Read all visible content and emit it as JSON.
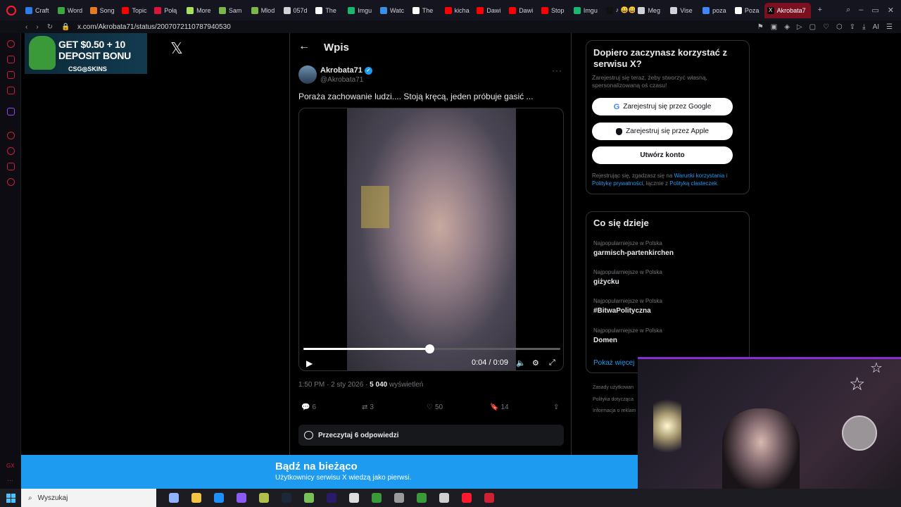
{
  "browser": {
    "tabs": [
      {
        "label": "Craft",
        "color": "#2b7de9"
      },
      {
        "label": "Word",
        "color": "#3ea63e"
      },
      {
        "label": "Song",
        "color": "#e37b26"
      },
      {
        "label": "Topic",
        "color": "#ff0000"
      },
      {
        "label": "Połą",
        "color": "#dc143c"
      },
      {
        "label": "More",
        "color": "#a8e05c"
      },
      {
        "label": "Sam",
        "color": "#7ab648"
      },
      {
        "label": "Mlod",
        "color": "#7ab648"
      },
      {
        "label": "057d",
        "color": "#cfd2d6"
      },
      {
        "label": "The",
        "color": "#ffffff"
      },
      {
        "label": "Imgu",
        "color": "#1bb76e"
      },
      {
        "label": "Watc",
        "color": "#3a8ee6"
      },
      {
        "label": "The",
        "color": "#ffffff"
      },
      {
        "label": "kicha",
        "color": "#ff0000"
      },
      {
        "label": "Dawi",
        "color": "#ff0000"
      },
      {
        "label": "Dawi",
        "color": "#ff0000"
      },
      {
        "label": "Stop",
        "color": "#ff0000"
      },
      {
        "label": "Imgu",
        "color": "#1bb76e"
      },
      {
        "label": "♪ 😀😀",
        "color": "#111111"
      },
      {
        "label": "Meg",
        "color": "#cfd2d6"
      },
      {
        "label": "Vise",
        "color": "#cfd2d6"
      },
      {
        "label": "poza",
        "color": "#4285f4"
      },
      {
        "label": "Poza",
        "color": "#ffffff"
      }
    ],
    "active_tab": "Akrobata7",
    "url": "x.com/Akrobata71/status/2007072110787940530"
  },
  "ad": {
    "line1": "GET $0.50 + 10",
    "line2": "DEPOSIT BONU",
    "brand": "CSG◎SKINS"
  },
  "x_logo": "𝕏",
  "post": {
    "header_title": "Wpis",
    "display_name": "Akrobata71",
    "handle": "@Akrobata71",
    "text": "Poraża zachowanie ludzi.... Stoją kręcą, jeden próbuje gasić ...",
    "video": {
      "current": "0:04",
      "total": "0:09",
      "time_display": "0:04 / 0:09",
      "progress": 0.49
    },
    "timestamp": "1:50 PM · 2 sty 2026 · ",
    "views_count": "5 040",
    "views_label": " wyświetleń",
    "replies": "6",
    "reposts": "3",
    "likes": "50",
    "bookmarks": "14",
    "read_replies": "Przeczytaj 6 odpowiedzi"
  },
  "signup": {
    "heading": "Dopiero zaczynasz korzystać z serwisu X?",
    "subtext": "Zarejestruj się teraz, żeby stworzyć własną, spersonalizowaną oś czasu!",
    "google_btn": "Zarejestruj się przez Google",
    "apple_btn": "Zarejestruj się przez Apple",
    "create_btn": "Utwórz konto",
    "legal_pre": "Rejestrując się, zgadzasz się na ",
    "legal_terms": "Warunki korzystania",
    "legal_and": " i ",
    "legal_privacy": "Politykę prywatności",
    "legal_mid": ", łącznie z ",
    "legal_cookies": "Polityką clasteczek",
    "legal_end": "."
  },
  "trends": {
    "heading": "Co się dzieje",
    "items": [
      {
        "context": "Najpopularniejsze w Polska",
        "name": "garmisch-partenkirchen"
      },
      {
        "context": "Najpopularniejsze w Polska",
        "name": "giżycku"
      },
      {
        "context": "Najpopularniejsze w Polska",
        "name": "#BitwaPolityczna"
      },
      {
        "context": "Najpopularniejsze w Polska",
        "name": "Domen"
      }
    ],
    "show_more": "Pokaż więcej"
  },
  "footer": {
    "l1": "Zasady użytkowan",
    "l2": "Polityka dotycząca",
    "l3": "Informacja o reklam"
  },
  "banner": {
    "title": "Bądź na bieżąco",
    "subtitle": "Użytkownicy serwisu X wiedzą jako pierwsi."
  },
  "taskbar": {
    "search_placeholder": "Wyszukaj",
    "apps": [
      "#8fb3ff",
      "#f4c542",
      "#1e90ff",
      "#8a5cf5",
      "#b0c04a",
      "#1b2838",
      "#78c05a",
      "#2a1a6a",
      "#dddddd",
      "#3a9a3a",
      "#9a9a9a",
      "#3a9a3a",
      "#cfcfcf",
      "#ff1b2d",
      "#cc2233"
    ]
  },
  "colors": {
    "accent": "#1d9bf0",
    "bg": "#000000",
    "opera": "#ff1b2d"
  }
}
